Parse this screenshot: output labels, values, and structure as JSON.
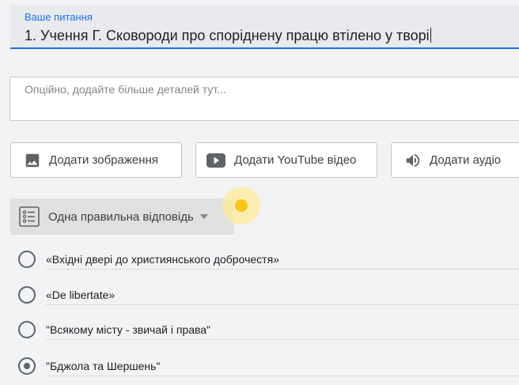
{
  "question": {
    "label": "Ваше питання",
    "value": "1. Учення Г. Сковороди про споріднену працю втілено у творі"
  },
  "details": {
    "placeholder": "Опційно, додайте більше деталей тут..."
  },
  "media_buttons": {
    "image": {
      "label": "Додати зображення",
      "icon": "image-icon"
    },
    "youtube": {
      "label": "Додати YouTube відео",
      "icon": "youtube-icon"
    },
    "audio": {
      "label": "Додати аудіо",
      "icon": "volume-icon"
    }
  },
  "answer_type": {
    "selected": "Одна правильна відповідь",
    "icon": "list-icon"
  },
  "options": [
    {
      "text": "«Вхідні двері до християнського доброчестя»",
      "selected": false
    },
    {
      "text": "«De libertate»",
      "selected": false
    },
    {
      "text": "\"Всякому місту - звичай і права\"",
      "selected": false
    },
    {
      "text": "\"Бджола та Шершень\"",
      "selected": true
    }
  ],
  "colors": {
    "accent": "#1a73e8",
    "background": "#f1f3f4",
    "icon": "#5f6368",
    "highlight": "#f9c51a"
  }
}
